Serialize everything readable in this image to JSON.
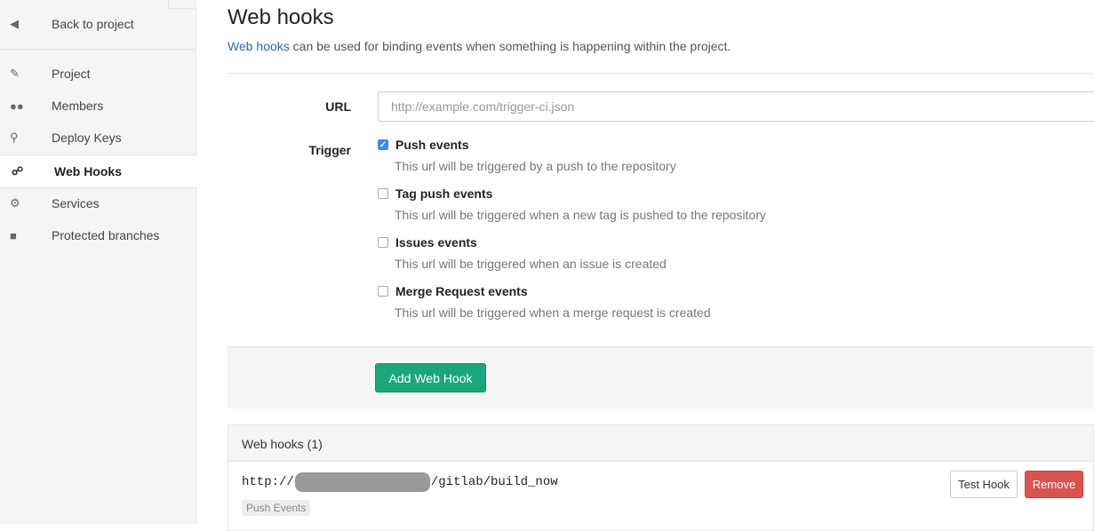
{
  "sidebar": {
    "back": {
      "label": "Back to project",
      "icon": "back-arrow-icon"
    },
    "items": [
      {
        "label": "Project",
        "icon": "edit-icon"
      },
      {
        "label": "Members",
        "icon": "users-icon"
      },
      {
        "label": "Deploy Keys",
        "icon": "key-icon"
      },
      {
        "label": "Web Hooks",
        "icon": "link-icon",
        "active": true
      },
      {
        "label": "Services",
        "icon": "cogs-icon"
      },
      {
        "label": "Protected branches",
        "icon": "lock-icon"
      }
    ]
  },
  "header": {
    "title": "Web hooks",
    "lead_link": "Web hooks",
    "lead_text": " can be used for binding events when something is happening within the project."
  },
  "form": {
    "url_label": "URL",
    "url_placeholder": "http://example.com/trigger-ci.json",
    "url_value": "",
    "trigger_label": "Trigger",
    "triggers": [
      {
        "label": "Push events",
        "checked": true,
        "description": "This url will be triggered by a push to the repository"
      },
      {
        "label": "Tag push events",
        "checked": false,
        "description": "This url will be triggered when a new tag is pushed to the repository"
      },
      {
        "label": "Issues events",
        "checked": false,
        "description": "This url will be triggered when an issue is created"
      },
      {
        "label": "Merge Request events",
        "checked": false,
        "description": "This url will be triggered when a merge request is created"
      }
    ],
    "submit_label": "Add Web Hook"
  },
  "hooks": {
    "title": "Web hooks (1)",
    "items": [
      {
        "url_prefix": "http://",
        "url_suffix": "/gitlab/build_now",
        "badge": "Push Events",
        "test_label": "Test Hook",
        "remove_label": "Remove"
      }
    ]
  },
  "colors": {
    "primary": "#1aa67d",
    "danger": "#d9534f",
    "link": "#2d6bb3",
    "checkbox": "#3b8ced"
  }
}
